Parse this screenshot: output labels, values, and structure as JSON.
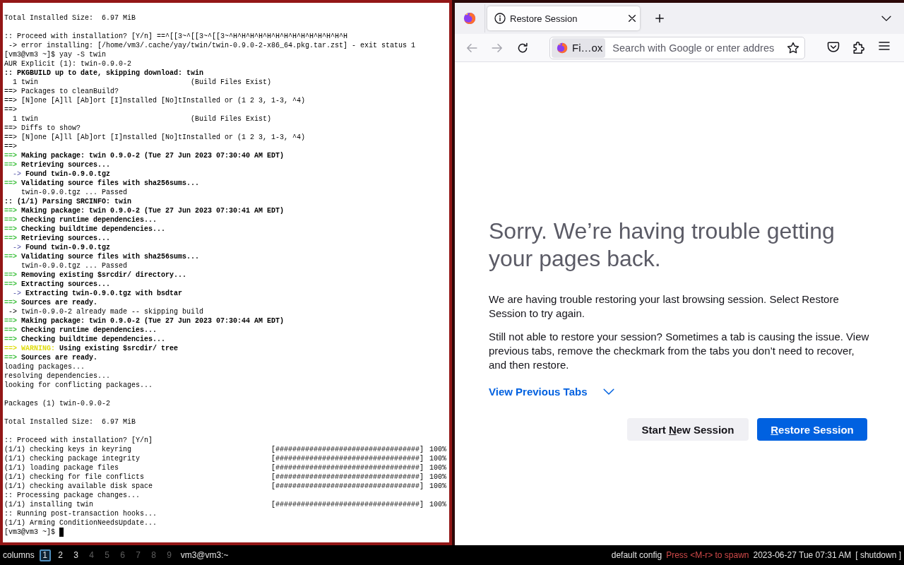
{
  "terminal": {
    "focused": true,
    "lines": [
      {
        "kind": "blank"
      },
      {
        "kind": "plain",
        "text": "Total Installed Size:  6.97 MiB"
      },
      {
        "kind": "blank"
      },
      {
        "kind": "plain",
        "text": ":: Proceed with installation? [Y/n] ==^[[3~^[[3~^[[3~^H^H^H^H^H^H^H^H^H^H^H^H^H^H"
      },
      {
        "kind": "plain",
        "text": " -> error installing: [/home/vm3/.cache/yay/twin/twin-0.9.0-2-x86_64.pkg.tar.zst] - exit status 1"
      },
      {
        "kind": "plain",
        "text": "[vm3@vm3 ~]$ yay -S twin"
      },
      {
        "kind": "plain",
        "text": "AUR Explicit (1): twin-0.9.0-2"
      },
      {
        "kind": "bold",
        "text": ":: PKGBUILD up to date, skipping download: twin"
      },
      {
        "kind": "package",
        "name": "1 twin",
        "note": "(Build Files Exist)"
      },
      {
        "kind": "plain",
        "text": "==> Packages to cleanBuild?"
      },
      {
        "kind": "plain",
        "text": "==> [N]one [A]ll [Ab]ort [I]nstalled [No]tInstalled or (1 2 3, 1-3, ^4)"
      },
      {
        "kind": "plain",
        "text": "==>"
      },
      {
        "kind": "package",
        "name": "1 twin",
        "note": "(Build Files Exist)"
      },
      {
        "kind": "plain",
        "text": "==> Diffs to show?"
      },
      {
        "kind": "plain",
        "text": "==> [N]one [A]ll [Ab]ort [I]nstalled [No]tInstalled or (1 2 3, 1-3, ^4)"
      },
      {
        "kind": "plain",
        "text": "==>"
      },
      {
        "kind": "step",
        "marker": "==>",
        "text": "Making package: twin 0.9.0-2 (Tue 27 Jun 2023 07:30:40 AM EDT)"
      },
      {
        "kind": "step",
        "marker": "==>",
        "text": "Retrieving sources..."
      },
      {
        "kind": "substep",
        "marker": "->",
        "text": "Found twin-0.9.0.tgz"
      },
      {
        "kind": "step",
        "marker": "==>",
        "text": "Validating source files with sha256sums..."
      },
      {
        "kind": "plain",
        "text": "    twin-0.9.0.tgz ... Passed"
      },
      {
        "kind": "bold",
        "text": ":: (1/1) Parsing SRCINFO: twin"
      },
      {
        "kind": "step",
        "marker": "==>",
        "text": "Making package: twin 0.9.0-2 (Tue 27 Jun 2023 07:30:41 AM EDT)"
      },
      {
        "kind": "step",
        "marker": "==>",
        "text": "Checking runtime dependencies..."
      },
      {
        "kind": "step",
        "marker": "==>",
        "text": "Checking buildtime dependencies..."
      },
      {
        "kind": "step",
        "marker": "==>",
        "text": "Retrieving sources..."
      },
      {
        "kind": "substep",
        "marker": "->",
        "text": "Found twin-0.9.0.tgz"
      },
      {
        "kind": "step",
        "marker": "==>",
        "text": "Validating source files with sha256sums..."
      },
      {
        "kind": "plain",
        "text": "    twin-0.9.0.tgz ... Passed"
      },
      {
        "kind": "step",
        "marker": "==>",
        "text": "Removing existing $srcdir/ directory..."
      },
      {
        "kind": "step",
        "marker": "==>",
        "text": "Extracting sources..."
      },
      {
        "kind": "substep",
        "marker": "->",
        "text": "Extracting twin-0.9.0.tgz with bsdtar"
      },
      {
        "kind": "step",
        "marker": "==>",
        "text": "Sources are ready."
      },
      {
        "kind": "plain",
        "text": " -> twin-0.9.0-2 already made -- skipping build"
      },
      {
        "kind": "step",
        "marker": "==>",
        "text": "Making package: twin 0.9.0-2 (Tue 27 Jun 2023 07:30:44 AM EDT)"
      },
      {
        "kind": "step",
        "marker": "==>",
        "text": "Checking runtime dependencies..."
      },
      {
        "kind": "step",
        "marker": "==>",
        "text": "Checking buildtime dependencies..."
      },
      {
        "kind": "warning",
        "marker": "==>",
        "label": "WARNING:",
        "text": "Using existing $srcdir/ tree"
      },
      {
        "kind": "step",
        "marker": "==>",
        "text": "Sources are ready."
      },
      {
        "kind": "plain",
        "text": "loading packages..."
      },
      {
        "kind": "plain",
        "text": "resolving dependencies..."
      },
      {
        "kind": "plain",
        "text": "looking for conflicting packages..."
      },
      {
        "kind": "blank"
      },
      {
        "kind": "plain",
        "text": "Packages (1) twin-0.9.0-2"
      },
      {
        "kind": "blank"
      },
      {
        "kind": "plain",
        "text": "Total Installed Size:  6.97 MiB"
      },
      {
        "kind": "blank"
      },
      {
        "kind": "plain",
        "text": ":: Proceed with installation? [Y/n]"
      },
      {
        "kind": "progress",
        "label": "(1/1) checking keys in keyring",
        "bar": "[##################################]",
        "percent": "100%"
      },
      {
        "kind": "progress",
        "label": "(1/1) checking package integrity",
        "bar": "[##################################]",
        "percent": "100%"
      },
      {
        "kind": "progress",
        "label": "(1/1) loading package files",
        "bar": "[##################################]",
        "percent": "100%"
      },
      {
        "kind": "progress",
        "label": "(1/1) checking for file conflicts",
        "bar": "[##################################]",
        "percent": "100%"
      },
      {
        "kind": "progress",
        "label": "(1/1) checking available disk space",
        "bar": "[##################################]",
        "percent": "100%"
      },
      {
        "kind": "plain",
        "text": ":: Processing package changes..."
      },
      {
        "kind": "progress",
        "label": "(1/1) installing twin",
        "bar": "[##################################]",
        "percent": "100%"
      },
      {
        "kind": "plain",
        "text": ":: Running post-transaction hooks..."
      },
      {
        "kind": "plain",
        "text": "(1/1) Arming ConditionNeedsUpdate..."
      },
      {
        "kind": "prompt",
        "text": "[vm3@vm3 ~]$"
      }
    ]
  },
  "browser": {
    "focused": false,
    "tabs": [
      {
        "title": "Restore Session",
        "selected": true
      }
    ],
    "nav_buttons": [
      {
        "kind": "back",
        "disabled": true
      },
      {
        "kind": "forward",
        "disabled": true
      },
      {
        "kind": "reload",
        "disabled": false
      }
    ],
    "address_bar": {
      "identity": "Fi…ox",
      "placeholder": "Search with Google or enter addres",
      "bookmarked": false
    },
    "toolbar_icons": [
      {
        "kind": "pocket"
      },
      {
        "kind": "extensions"
      },
      {
        "kind": "menu"
      }
    ],
    "page": {
      "title": "Sorry. We’re having trouble getting your pages back.",
      "paragraphs": [
        "We are having trouble restoring your last browsing session. Select Restore Session to try again.",
        "Still not able to restore your session? Sometimes a tab is causing the issue. View previous tabs, remove the checkmark from the tabs you don’t need to recover, and then restore."
      ],
      "tabs_toggle": {
        "label": "View Previous Tabs",
        "expanded": false
      },
      "buttons": [
        {
          "kind": "secondary",
          "label": [
            {
              "text": "Start ",
              "underlined": false
            },
            {
              "text": "N",
              "underlined": true
            },
            {
              "text": "ew Session",
              "underlined": false
            }
          ]
        },
        {
          "kind": "primary",
          "label": [
            {
              "text": "R",
              "underlined": true
            },
            {
              "text": "estore Session",
              "underlined": false
            }
          ]
        }
      ]
    }
  },
  "status_bar": {
    "layout": "columns",
    "workspaces": [
      {
        "label": "1",
        "selected": true,
        "occupied": true
      },
      {
        "label": "2",
        "selected": false,
        "occupied": true
      },
      {
        "label": "3",
        "selected": false,
        "occupied": true
      },
      {
        "label": "4",
        "selected": false,
        "occupied": false
      },
      {
        "label": "5",
        "selected": false,
        "occupied": false
      },
      {
        "label": "6",
        "selected": false,
        "occupied": false
      },
      {
        "label": "7",
        "selected": false,
        "occupied": false
      },
      {
        "label": "8",
        "selected": false,
        "occupied": false
      },
      {
        "label": "9",
        "selected": false,
        "occupied": false
      }
    ],
    "window_title": "vm3@vm3:~",
    "config": "default config",
    "hint": "Press <M-r> to spawn",
    "clock": "2023-06-27 Tue 07:31 AM",
    "shutdown": "[ shutdown ]"
  }
}
